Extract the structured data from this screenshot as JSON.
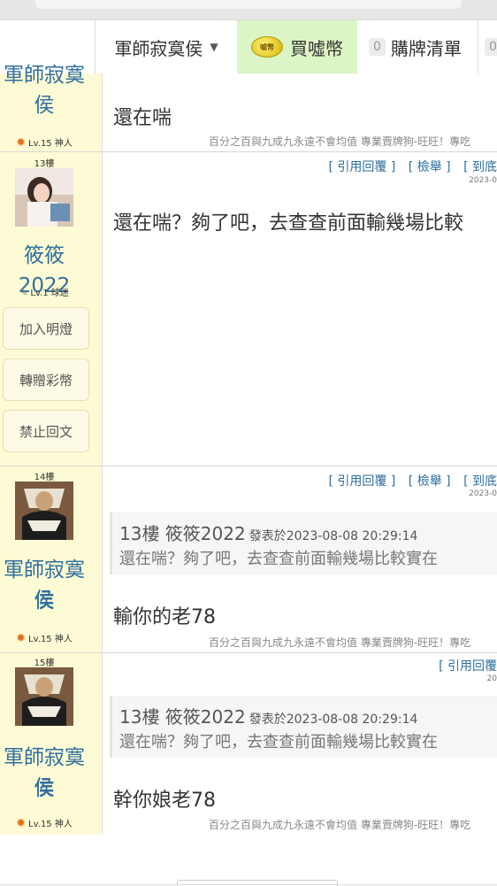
{
  "nav": {
    "user_menu": "軍師寂寞侯",
    "buy_coins": "買噓幣",
    "coin_label": "噓幣",
    "cart_count": "0",
    "cart_label": "購牌清單",
    "extra_count": "0"
  },
  "post_prev": {
    "author_tail": "軍師寂寞侯",
    "level": "Lv.15 神人",
    "body": "還在喘",
    "signature": "百分之百與九成九永遠不會均值 專業賣牌狗-旺旺！專吃"
  },
  "post13": {
    "floor": "13樓",
    "author": "筱筱2022",
    "level": "Lv.1 球迷",
    "buttons": [
      "加入明燈",
      "轉贈彩幣",
      "禁止回文"
    ],
    "links": [
      "[ 引用回覆 ]",
      "[ 檢舉 ]",
      "[ 到底"
    ],
    "timestamp": "2023-0",
    "body": "還在喘？夠了吧，去查查前面輸幾場比較"
  },
  "post14": {
    "floor": "14樓",
    "author": "軍師寂寞侯",
    "level": "Lv.15 神人",
    "links": [
      "[ 引用回覆 ]",
      "[ 檢舉 ]",
      "[ 到底"
    ],
    "timestamp": "2023-0",
    "quote_header": "13樓  筱筱2022",
    "quote_meta": "發表於2023-08-08 20:29:14",
    "quote_body": "還在喘？夠了吧，去查查前面輸幾場比較實在",
    "body": "輸你的老78",
    "signature": "百分之百與九成九永遠不會均值 專業賣牌狗-旺旺！專吃"
  },
  "post15": {
    "floor": "15樓",
    "author": "軍師寂寞侯",
    "level": "Lv.15 神人",
    "links": [
      "[ 引用回覆"
    ],
    "timestamp": "20",
    "quote_header": "13樓  筱筱2022",
    "quote_meta": "發表於2023-08-08 20:29:14",
    "quote_body": "還在喘？夠了吧，去查查前面輸幾場比較實在",
    "body": "幹你娘老78",
    "signature": "百分之百與九成九永遠不會均值 專業賣牌狗-旺旺！專吃"
  }
}
